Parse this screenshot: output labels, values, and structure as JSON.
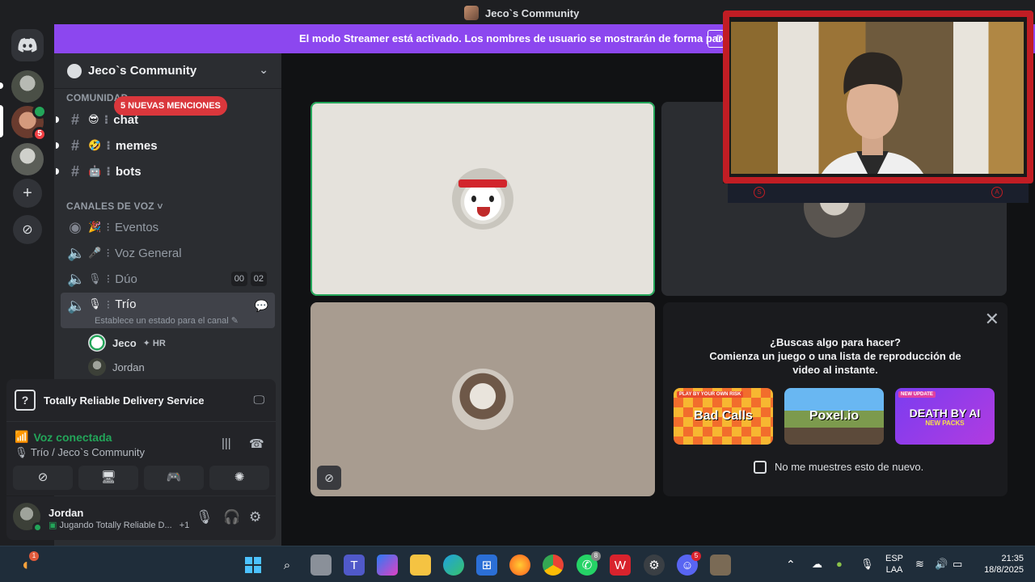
{
  "window": {
    "title": "Jeco`s Community"
  },
  "banner": {
    "text": "El modo Streamer está activado. Los nombres de usuario se mostrarán de forma parcial.",
    "button_label": "D"
  },
  "server": {
    "name": "Jeco`s Community",
    "mentions_pill": "5 NUEVAS MENCIONES",
    "server_badge": "5",
    "categories": {
      "community": "COMUNIDAD",
      "voice": "CANALES DE VOZ"
    },
    "text_channels": [
      {
        "name": "chat",
        "emoji": "😎"
      },
      {
        "name": "memes",
        "emoji": "🤣"
      },
      {
        "name": "bots",
        "emoji": "🤖"
      }
    ],
    "voice_channels": [
      {
        "name": "Eventos",
        "emoji": "🎉"
      },
      {
        "name": "Voz General",
        "emoji": "🎤"
      },
      {
        "name": "Dúo",
        "emoji": "🎙",
        "count_left": "00",
        "count_right": "02"
      },
      {
        "name": "Trío",
        "emoji": "🎙",
        "status_hint": "Establece un estado para el canal"
      }
    ],
    "voice_users": [
      {
        "name": "Jeco",
        "tag": "HR"
      },
      {
        "name": "Jordan"
      }
    ]
  },
  "activity": {
    "game": "Totally Reliable Delivery Service",
    "icon": "?"
  },
  "voice": {
    "status": "Voz conectada",
    "location": "Trío / Jeco`s Community"
  },
  "user": {
    "name": "Jordan",
    "status": "Jugando Totally Reliable D...",
    "extra": "+1"
  },
  "suggestion": {
    "question": "¿Buscas algo para hacer?",
    "prompt": "Comienza un juego o una lista de reproducción de video al instante.",
    "activities": [
      {
        "name": "Bad Calls",
        "ribbon": "PLAY BY YOUR OWN RISK"
      },
      {
        "name": "Poxel.io"
      },
      {
        "name": "DEATH BY AI",
        "sub": "NEW PACKS",
        "ribbon": "NEW UPDATE"
      }
    ],
    "dont_show": "No me muestres esto de nuevo."
  },
  "taskbar": {
    "lang_top": "ESP",
    "lang_bottom": "LAA",
    "time": "21:35",
    "date": "18/8/2025",
    "badges": {
      "start": "1",
      "whatsapp": "8",
      "discord": "5"
    }
  },
  "colors": {
    "streamer_banner": "#8c47ef",
    "voice_connected": "#23a559",
    "mention_red": "#da373c",
    "cam_frame": "#c11d24"
  }
}
